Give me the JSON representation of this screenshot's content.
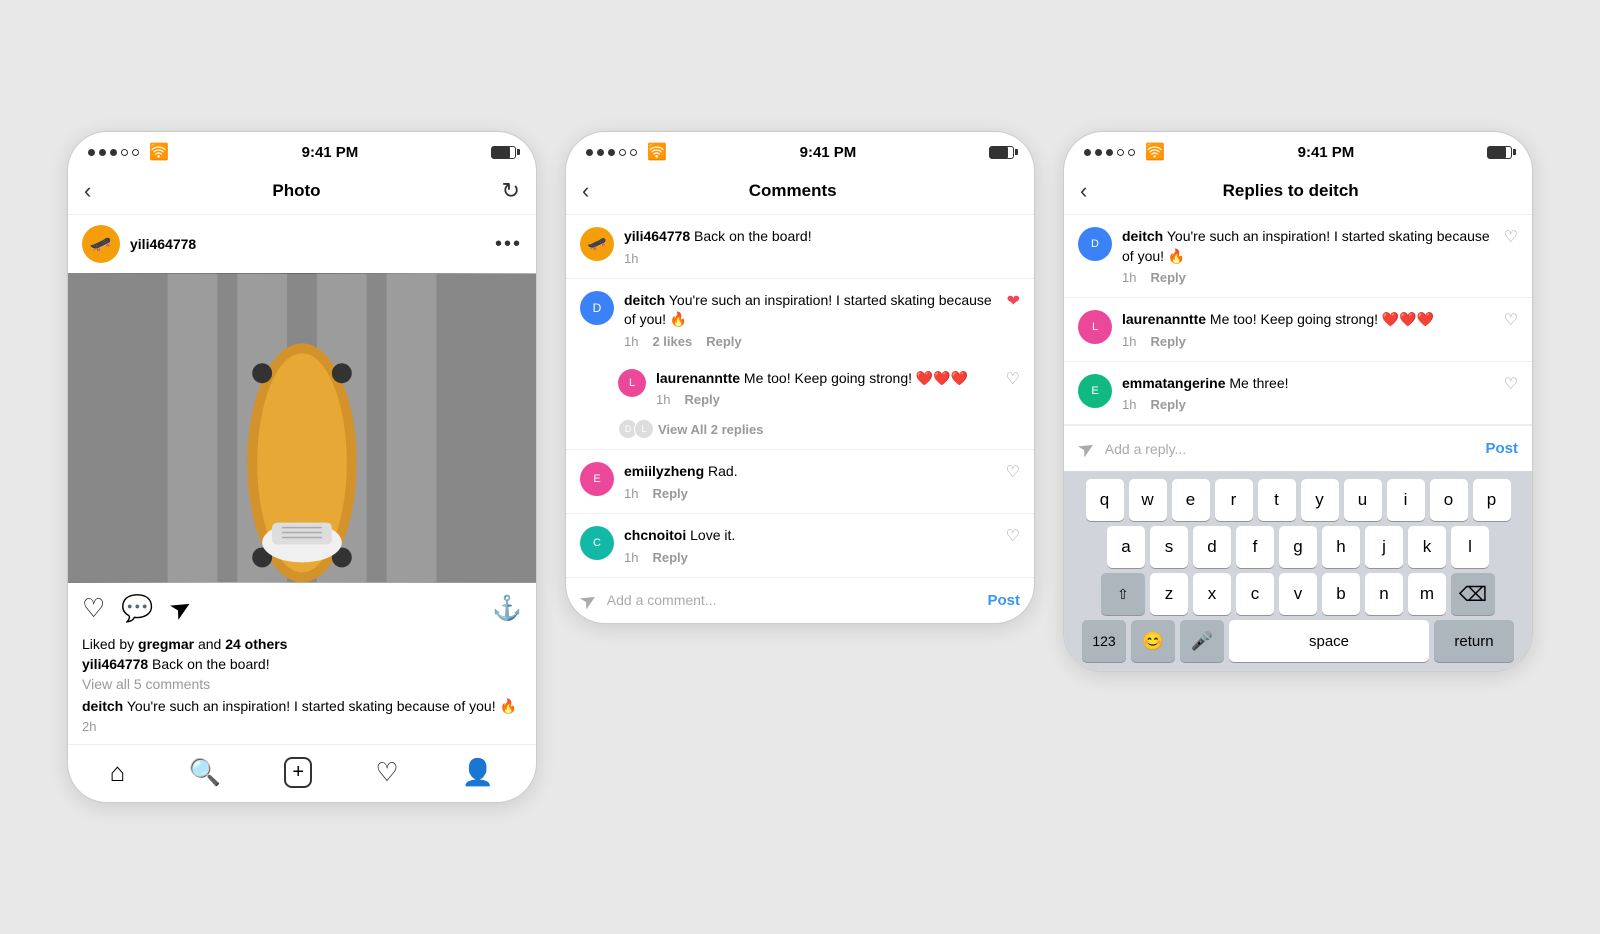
{
  "phones": {
    "phone1": {
      "title": "Photo",
      "status": {
        "time": "9:41 PM"
      },
      "user": {
        "name": "yili464778"
      },
      "liked_by": "Liked by ",
      "liked_by_user": "gregmar",
      "liked_by_suffix": " and ",
      "liked_by_others": "24 others",
      "caption_user": "yili464778",
      "caption_text": " Back on the board!",
      "view_comments": "View all 5 comments",
      "comment_user": "deitch",
      "comment_text": " You're such an inspiration! I started skating because of you! 🔥",
      "comment_time": "2h",
      "bottom_nav": [
        "home",
        "search",
        "add",
        "heart",
        "profile"
      ]
    },
    "phone2": {
      "title": "Comments",
      "status": {
        "time": "9:41 PM"
      },
      "top_comment": {
        "user": "yili464778",
        "text": " Back on the board!",
        "time": "1h"
      },
      "comments": [
        {
          "user": "deitch",
          "text": "You're such an inspiration! I started skating because of you! 🔥",
          "time": "1h",
          "likes": "2 likes",
          "liked": true,
          "has_replies": true
        },
        {
          "user": "laurenanntte",
          "text": "Me too! Keep going strong! ❤️❤️❤️",
          "time": "1h",
          "liked": false,
          "is_reply": true
        }
      ],
      "view_replies": "View All 2 replies",
      "comment2": {
        "user": "emiilyzheng",
        "text": "Rad.",
        "time": "1h"
      },
      "comment3": {
        "user": "chcnoitoi",
        "text": "Love it.",
        "time": "1h"
      },
      "add_comment_placeholder": "Add a comment...",
      "post_label": "Post"
    },
    "phone3": {
      "title": "Replies to deitch",
      "status": {
        "time": "9:41 PM"
      },
      "replies": [
        {
          "user": "deitch",
          "text": "You're such an inspiration! I started skating because of you! 🔥",
          "time": "1h",
          "reply_label": "Reply"
        },
        {
          "user": "laurenanntte",
          "text": "Me too! Keep going strong! ❤️❤️❤️",
          "time": "1h",
          "reply_label": "Reply"
        },
        {
          "user": "emmatangerine",
          "text": "Me three!",
          "time": "1h",
          "reply_label": "Reply"
        }
      ],
      "add_reply_placeholder": "Add a reply...",
      "post_label": "Post",
      "keyboard": {
        "row1": [
          "q",
          "w",
          "e",
          "r",
          "t",
          "y",
          "u",
          "i",
          "o",
          "p"
        ],
        "row2": [
          "a",
          "s",
          "d",
          "f",
          "g",
          "h",
          "j",
          "k",
          "l"
        ],
        "row3": [
          "z",
          "x",
          "c",
          "v",
          "b",
          "n",
          "m"
        ],
        "special": {
          "shift": "⇧",
          "backspace": "⌫",
          "numbers": "123",
          "emoji": "😊",
          "mic": "🎤",
          "space": "space",
          "return": "return"
        }
      }
    }
  }
}
